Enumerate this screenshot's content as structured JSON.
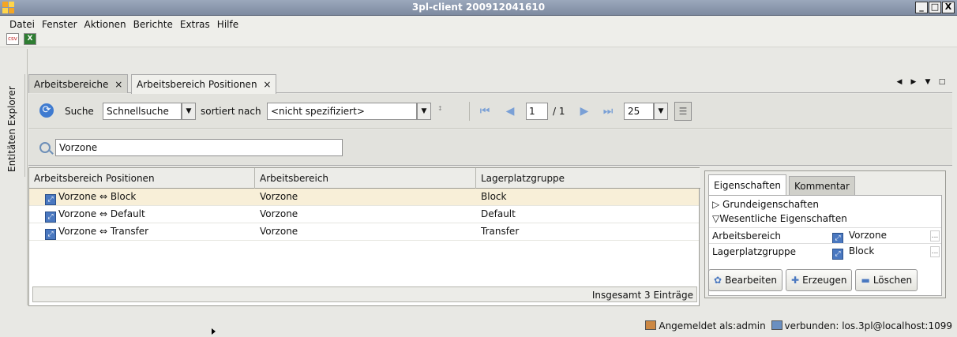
{
  "window": {
    "title": "3pl-client 200912041610",
    "buttons": [
      "_",
      "□",
      "X"
    ]
  },
  "menu": {
    "items": [
      "Datei",
      "Fenster",
      "Aktionen",
      "Berichte",
      "Extras",
      "Hilfe"
    ]
  },
  "toolbar_icons": {
    "csv_label": "csv",
    "excel_label": "X"
  },
  "sidebar": {
    "explorer_label": "Entitäten Explorer"
  },
  "tabs": [
    {
      "label": "Arbeitsbereiche",
      "close": "×"
    },
    {
      "label": "Arbeitsbereich Positionen",
      "close": "×"
    }
  ],
  "toolbar": {
    "search_label": "Suche",
    "search_mode": "Schnellsuche",
    "sorted_label": "sortiert nach",
    "sort_value": "<nicht spezifiziert>",
    "page_current": "1",
    "page_total": "/ 1",
    "page_size": "25"
  },
  "search": {
    "value": "Vorzone"
  },
  "table": {
    "columns": [
      "Arbeitsbereich Positionen",
      "Arbeitsbereich",
      "Lagerplatzgruppe"
    ],
    "rows": [
      {
        "position": "Vorzone ⇔ Block",
        "area": "Vorzone",
        "group": "Block",
        "selected": true
      },
      {
        "position": "Vorzone ⇔ Default",
        "area": "Vorzone",
        "group": "Default",
        "selected": false
      },
      {
        "position": "Vorzone ⇔ Transfer",
        "area": "Vorzone",
        "group": "Transfer",
        "selected": false
      }
    ],
    "footer": "Insgesamt 3 Einträge"
  },
  "panel": {
    "tabs": [
      "Eigenschaften",
      "Kommentar"
    ],
    "section_basic": "Grundeigenschaften",
    "section_essential": "Wesentliche Eigenschaften",
    "props": [
      {
        "key": "Arbeitsbereich",
        "value": "Vorzone"
      },
      {
        "key": "Lagerplatzgruppe",
        "value": "Block"
      }
    ],
    "buttons": {
      "edit": "Bearbeiten",
      "create": "Erzeugen",
      "delete": "Löschen"
    }
  },
  "status": {
    "logged_in": "Angemeldet als:admin",
    "connection": "verbunden: los.3pl@localhost:1099"
  },
  "colors": {
    "titlebar": "#8a97ad",
    "selected_row": "#f8efd8",
    "icon_blue": "#4a78c0"
  }
}
